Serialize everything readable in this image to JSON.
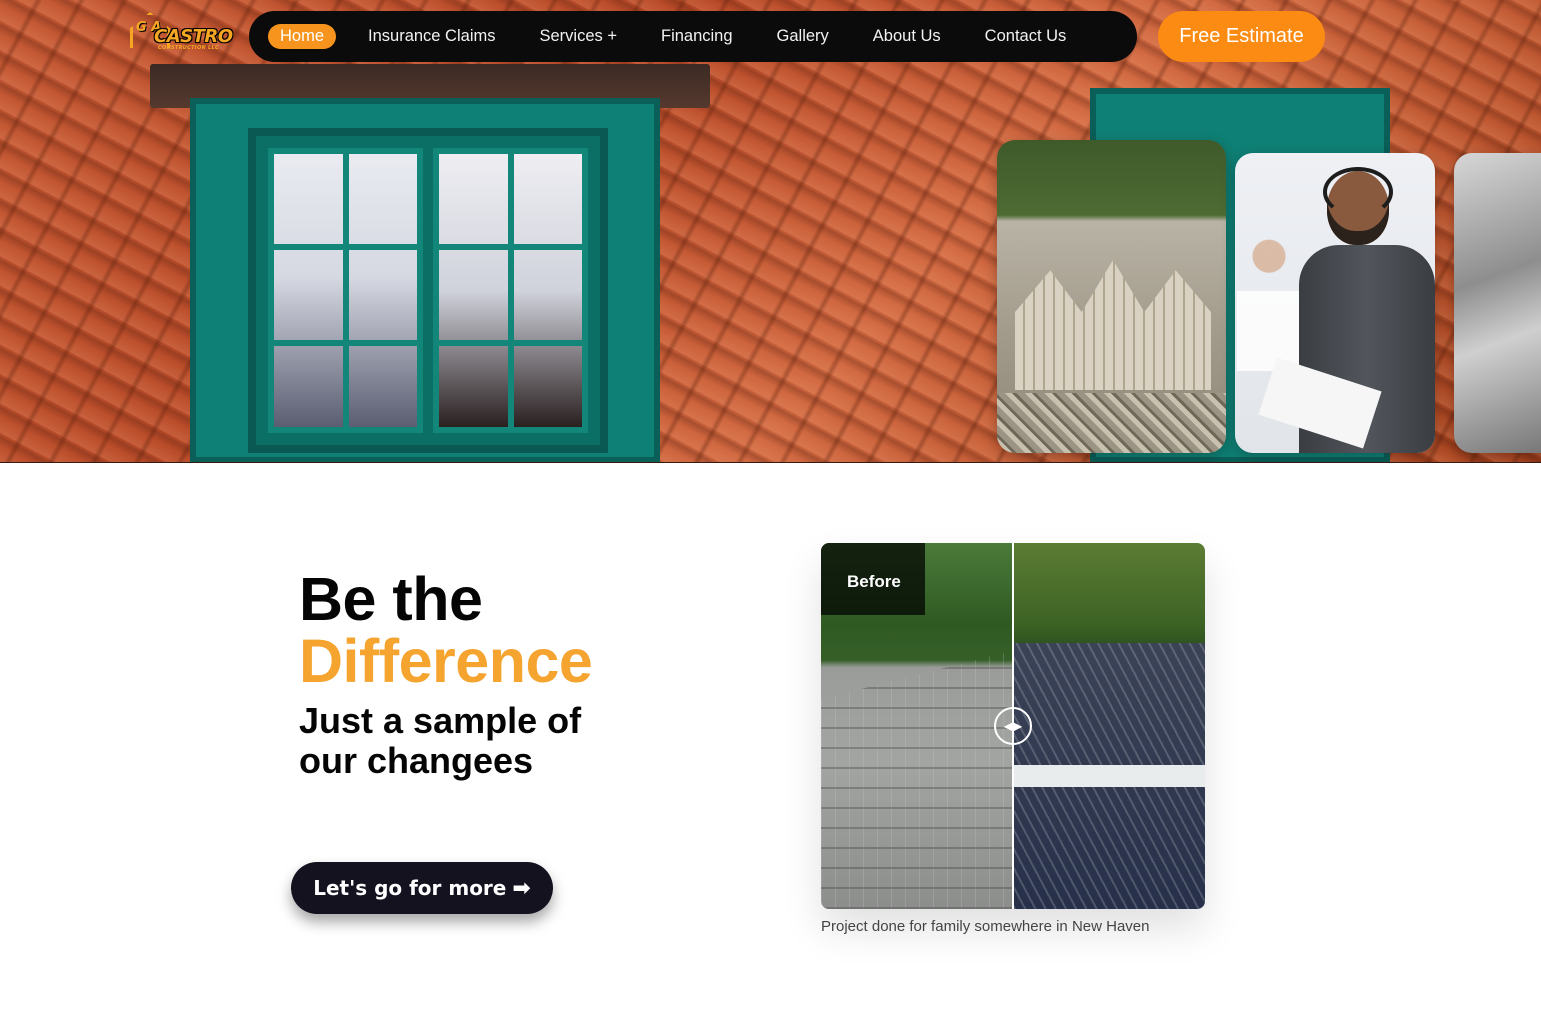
{
  "brand": {
    "logo_text": "CASTRO",
    "logo_sub": "CONSTRUCTION LLC",
    "logo_initials": "G A"
  },
  "nav": {
    "items": [
      "Home",
      "Insurance Claims",
      "Services +",
      "Financing",
      "Gallery",
      "About Us",
      "Contact Us"
    ],
    "active": "Home",
    "cta_label": "Free Estimate"
  },
  "colors": {
    "accent": "#f7941d",
    "nav_bg": "#0b0b0b",
    "headline_accent": "#f5a430",
    "cta_dark": "#14121f"
  },
  "main": {
    "headline_line1": "Be the",
    "headline_line2": "Difference",
    "subhead": "Just a sample of our changees",
    "cta_label": "Let's go for more",
    "cta_icon": "arrow-right-icon"
  },
  "comparison": {
    "before_label": "Before",
    "handle_icon": "drag-arrows-icon",
    "caption": "Project done for family somewhere in New Haven"
  }
}
